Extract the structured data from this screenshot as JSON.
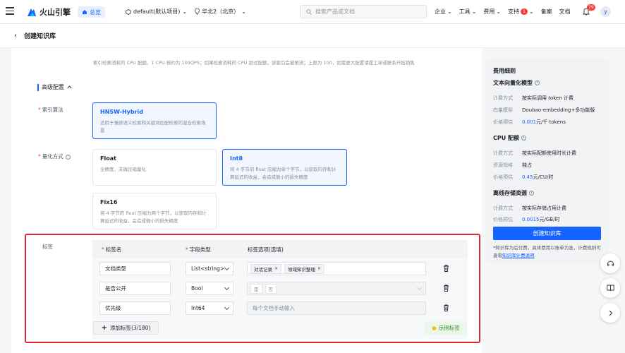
{
  "topbar": {
    "brand": "火山引擎",
    "overview": "总览",
    "project": "default(默认项目)",
    "region": "华北2（北京）",
    "search_placeholder": "搜索产品或文档",
    "nav": {
      "enterprise": "企业",
      "tools": "工具",
      "billing": "费用",
      "support": "支持",
      "support_badge": "1",
      "filing": "备案",
      "docs": "文档"
    },
    "bell_badge": "79",
    "avatar": "y"
  },
  "page": {
    "title": "创建知识库"
  },
  "form": {
    "note": "索引检索消耗的 CPU 配额，1 CPU 核约为 100QPS；如果检索消耗的 CPU 超过配额，该索引会被限流；上限为 100，如需更大配置请提工单或联系开拓销售",
    "advanced": "高级配置",
    "algo_label": "索引算法",
    "algo": {
      "title": "HNSW-Hybrid",
      "desc": "适用于兼顾语义检索和关键词匹配检索的混合检索场景"
    },
    "quant_label": "量化方式",
    "quant": [
      {
        "title": "Float",
        "desc": "全精度，未做压缩量化"
      },
      {
        "title": "Int8",
        "desc": "将 4 字节的 float 压缩为单个字节，以获取内存和计算延迟的收益，会造成微小的损失精度"
      },
      {
        "title": "Fix16",
        "desc": "将 4 字节的 float 压缩为两个字节，以获取内存和计算延迟的收益，会造成微小的损失精度"
      }
    ],
    "tag_label": "标签",
    "columns": {
      "name": "标签名",
      "type": "字段类型",
      "options": "标签选项(选填)"
    },
    "rows": [
      {
        "name": "文档类型",
        "type": "List<string>",
        "chips": [
          "对话记录",
          "领域知识整理"
        ]
      },
      {
        "name": "是否公开",
        "type": "Bool",
        "chips": [
          "是",
          "否"
        ]
      },
      {
        "name": "优先级",
        "type": "Int64",
        "placeholder": "每个文档手动输入"
      }
    ],
    "add_tag": "添加标签(3/180)",
    "example_tag": "示例标签"
  },
  "sidebar": {
    "title": "费用细则",
    "vector_model": "文本向量化模型",
    "vm_rows": [
      {
        "k": "计费方式",
        "v": "按实际调用 token 计费"
      },
      {
        "k": "向量模型",
        "v": "Doubao-embedding+多功能版"
      }
    ],
    "vm_price_k": "价格预估",
    "vm_price_v": "0.001",
    "vm_price_unit": "元/千 tokens",
    "cpu": "CPU 配额",
    "cpu_rows": [
      {
        "k": "计费方式",
        "v": "按实际配额使用时长计费"
      },
      {
        "k": "资源规格",
        "v": "独占"
      }
    ],
    "cpu_price_k": "价格预估",
    "cpu_price_v": "0.45",
    "cpu_price_unit": "元/CU/时",
    "storage": "离线存储资源",
    "st_rows": [
      {
        "k": "计费方式",
        "v": "按实际存储占用计费"
      }
    ],
    "st_price_k": "价格预估",
    "st_price_v": "0.0015",
    "st_price_unit": "元/GB/时",
    "create_btn": "创建知识库",
    "footnote": "*知识库为后付费，具体费用以账单为准，计费规则可查看",
    "footnote_link": "知识库计费说明"
  },
  "colors": {
    "accent": "#1664ff",
    "highlight_box": "#e0262b"
  }
}
